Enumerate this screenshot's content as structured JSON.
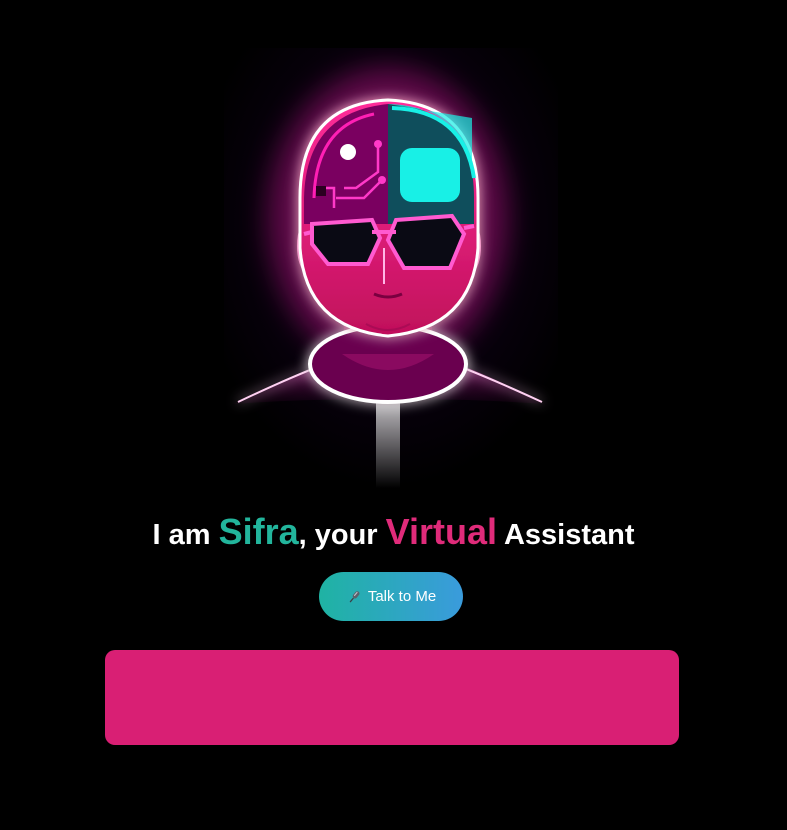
{
  "avatar": {
    "alt": "Sifra virtual assistant avatar"
  },
  "headline": {
    "prefix": "I am ",
    "name": "Sifra",
    "middle": ", your ",
    "highlight": "Virtual",
    "suffix": " Assistant"
  },
  "talk_button": {
    "icon": "microphone-icon",
    "label": "Talk to Me"
  },
  "output_panel": {
    "text": ""
  },
  "colors": {
    "background": "#000000",
    "name_accent": "#22b59c",
    "virtual_accent": "#e02b7a",
    "button_gradient_start": "#1fb3a3",
    "button_gradient_end": "#3a9bdc",
    "panel": "#d91f74",
    "neon_pink": "#ff1fb4",
    "neon_cyan": "#18f0e6"
  }
}
